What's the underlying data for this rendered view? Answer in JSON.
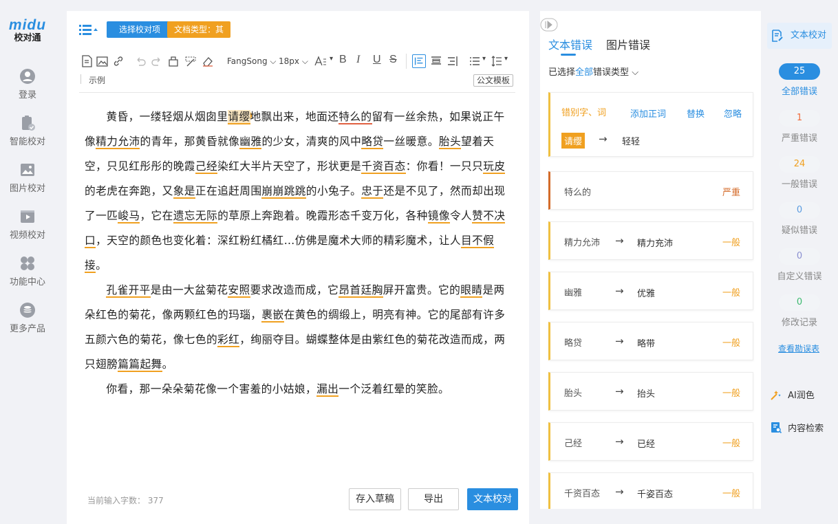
{
  "brand": {
    "name_en": "midu",
    "name_cn": "校对通"
  },
  "nav": [
    {
      "id": "login",
      "label": "登录",
      "icon": "user-icon"
    },
    {
      "id": "smart",
      "label": "智能校对",
      "icon": "clipboard-check-icon"
    },
    {
      "id": "image",
      "label": "图片校对",
      "icon": "image-icon"
    },
    {
      "id": "video",
      "label": "视频校对",
      "icon": "video-icon"
    },
    {
      "id": "func",
      "label": "功能中心",
      "icon": "grid-icon"
    },
    {
      "id": "more",
      "label": "更多产品",
      "icon": "database-icon"
    }
  ],
  "editor": {
    "select_btn": "选择校对项",
    "doc_type": "文档类型：其他",
    "font": "FangSong",
    "size": "18px",
    "sample": "示例",
    "template": "公文模板",
    "word_count_label": "当前输入字数：",
    "word_count": "377",
    "draft_btn": "存入草稿",
    "export_btn": "导出",
    "proof_btn": "文本校对"
  },
  "doc": {
    "p1": [
      "黄昏，一缕轻烟从烟囱里",
      "请缨",
      "地飘出来，地面还",
      "特么的",
      "留有一丝余热，如果说正午像",
      "精力允沛",
      "的青年，那黄昏就像",
      "幽雅",
      "的少女，清爽的风中",
      "略贷",
      "一丝暖意。",
      "胎头",
      "望着天空，只见红彤彤的晚霞",
      "己经",
      "染红大半片天空了，形状更是",
      "千资百态",
      "：你看！一只只",
      "玩皮",
      "的老虎在奔跑，又",
      "象是",
      "正在追赶周围",
      "崩崩跳跳",
      "的小兔子。",
      "忠于",
      "还是不见了，然而却出现了一匹",
      "峻马",
      "，它在",
      "遗忘无际",
      "的草原上奔跑着。晚霞形态千变万化，各种",
      "镜像",
      "令人",
      "赞不决口",
      "，天空的颜色也变化着：深红粉红橘红…仿佛是魔术大师的精彩魔术，让人",
      "目不假接",
      "。"
    ],
    "p2": [
      "",
      "孔雀开平",
      "是由一大盆菊花",
      "安照",
      "要求改造而成，它",
      "昂首廷胸",
      "屏开富贵。它的",
      "眼睛",
      "是两朵红色的菊花，像两颗红色的玛瑙，",
      "裹嵌",
      "在黄色的绸缎上，明亮有神。它的尾部有许多五颜六色的菊花，像七色的",
      "彩红",
      "，绚丽夺目。蝴蝶整体是由紫红色的菊花改造而成，两只翅膀",
      "篇篇起舞",
      "。"
    ],
    "p3": [
      "你看，那一朵朵菊花像一个害羞的小姑娘，",
      "漏出",
      "一个泛着红晕的笑脸。"
    ],
    "marker": "!"
  },
  "panel": {
    "tab_text": "文本错误",
    "tab_image": "图片错误",
    "filter_prefix": "已选择",
    "filter_all": "全部",
    "filter_suffix": "错误类型",
    "first": {
      "type": "错别字、词",
      "add": "添加正词",
      "replace": "替换",
      "ignore": "忽略",
      "from": "请缨",
      "to": "轻轻"
    },
    "cards": [
      {
        "from": "特么的",
        "to": "",
        "level": "严重",
        "severe": true
      },
      {
        "from": "精力允沛",
        "to": "精力充沛",
        "level": "一般"
      },
      {
        "from": "幽雅",
        "to": "优雅",
        "level": "一般"
      },
      {
        "from": "略贷",
        "to": "略带",
        "level": "一般"
      },
      {
        "from": "胎头",
        "to": "抬头",
        "level": "一般"
      },
      {
        "from": "己经",
        "to": "已经",
        "level": "一般"
      },
      {
        "from": "千资百态",
        "to": "千姿百态",
        "level": "一般"
      }
    ]
  },
  "side": {
    "top_btn": "文本校对",
    "stats": [
      {
        "value": "25",
        "label": "全部错误",
        "style": "blue"
      },
      {
        "value": "1",
        "label": "严重错误",
        "style": "orange"
      },
      {
        "value": "24",
        "label": "一般错误",
        "style": "orange"
      },
      {
        "value": "0",
        "label": "疑似错误",
        "style": "blue-light"
      },
      {
        "value": "0",
        "label": "自定义错误",
        "style": "grey"
      },
      {
        "value": "0",
        "label": "修改记录",
        "style": "green"
      }
    ],
    "help": "查看勘误表",
    "ai": "AI润色",
    "search": "内容检索"
  },
  "colors": {
    "accent": "#2a8ee0",
    "warn": "#f0a020",
    "severe": "#d46b2a"
  }
}
